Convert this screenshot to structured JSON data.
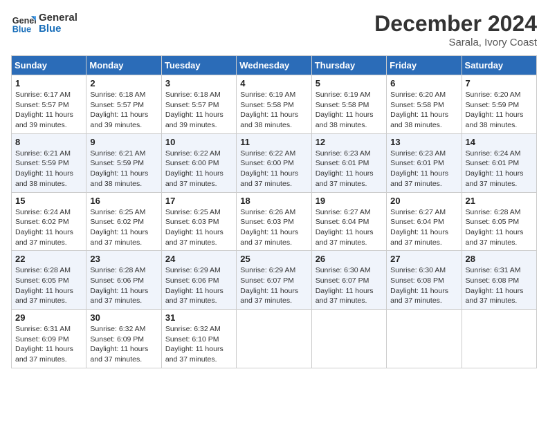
{
  "header": {
    "logo_line1": "General",
    "logo_line2": "Blue",
    "month": "December 2024",
    "location": "Sarala, Ivory Coast"
  },
  "days_of_week": [
    "Sunday",
    "Monday",
    "Tuesday",
    "Wednesday",
    "Thursday",
    "Friday",
    "Saturday"
  ],
  "weeks": [
    [
      {
        "day": "1",
        "info": "Sunrise: 6:17 AM\nSunset: 5:57 PM\nDaylight: 11 hours and 39 minutes."
      },
      {
        "day": "2",
        "info": "Sunrise: 6:18 AM\nSunset: 5:57 PM\nDaylight: 11 hours and 39 minutes."
      },
      {
        "day": "3",
        "info": "Sunrise: 6:18 AM\nSunset: 5:57 PM\nDaylight: 11 hours and 39 minutes."
      },
      {
        "day": "4",
        "info": "Sunrise: 6:19 AM\nSunset: 5:58 PM\nDaylight: 11 hours and 38 minutes."
      },
      {
        "day": "5",
        "info": "Sunrise: 6:19 AM\nSunset: 5:58 PM\nDaylight: 11 hours and 38 minutes."
      },
      {
        "day": "6",
        "info": "Sunrise: 6:20 AM\nSunset: 5:58 PM\nDaylight: 11 hours and 38 minutes."
      },
      {
        "day": "7",
        "info": "Sunrise: 6:20 AM\nSunset: 5:59 PM\nDaylight: 11 hours and 38 minutes."
      }
    ],
    [
      {
        "day": "8",
        "info": "Sunrise: 6:21 AM\nSunset: 5:59 PM\nDaylight: 11 hours and 38 minutes."
      },
      {
        "day": "9",
        "info": "Sunrise: 6:21 AM\nSunset: 5:59 PM\nDaylight: 11 hours and 38 minutes."
      },
      {
        "day": "10",
        "info": "Sunrise: 6:22 AM\nSunset: 6:00 PM\nDaylight: 11 hours and 37 minutes."
      },
      {
        "day": "11",
        "info": "Sunrise: 6:22 AM\nSunset: 6:00 PM\nDaylight: 11 hours and 37 minutes."
      },
      {
        "day": "12",
        "info": "Sunrise: 6:23 AM\nSunset: 6:01 PM\nDaylight: 11 hours and 37 minutes."
      },
      {
        "day": "13",
        "info": "Sunrise: 6:23 AM\nSunset: 6:01 PM\nDaylight: 11 hours and 37 minutes."
      },
      {
        "day": "14",
        "info": "Sunrise: 6:24 AM\nSunset: 6:01 PM\nDaylight: 11 hours and 37 minutes."
      }
    ],
    [
      {
        "day": "15",
        "info": "Sunrise: 6:24 AM\nSunset: 6:02 PM\nDaylight: 11 hours and 37 minutes."
      },
      {
        "day": "16",
        "info": "Sunrise: 6:25 AM\nSunset: 6:02 PM\nDaylight: 11 hours and 37 minutes."
      },
      {
        "day": "17",
        "info": "Sunrise: 6:25 AM\nSunset: 6:03 PM\nDaylight: 11 hours and 37 minutes."
      },
      {
        "day": "18",
        "info": "Sunrise: 6:26 AM\nSunset: 6:03 PM\nDaylight: 11 hours and 37 minutes."
      },
      {
        "day": "19",
        "info": "Sunrise: 6:27 AM\nSunset: 6:04 PM\nDaylight: 11 hours and 37 minutes."
      },
      {
        "day": "20",
        "info": "Sunrise: 6:27 AM\nSunset: 6:04 PM\nDaylight: 11 hours and 37 minutes."
      },
      {
        "day": "21",
        "info": "Sunrise: 6:28 AM\nSunset: 6:05 PM\nDaylight: 11 hours and 37 minutes."
      }
    ],
    [
      {
        "day": "22",
        "info": "Sunrise: 6:28 AM\nSunset: 6:05 PM\nDaylight: 11 hours and 37 minutes."
      },
      {
        "day": "23",
        "info": "Sunrise: 6:28 AM\nSunset: 6:06 PM\nDaylight: 11 hours and 37 minutes."
      },
      {
        "day": "24",
        "info": "Sunrise: 6:29 AM\nSunset: 6:06 PM\nDaylight: 11 hours and 37 minutes."
      },
      {
        "day": "25",
        "info": "Sunrise: 6:29 AM\nSunset: 6:07 PM\nDaylight: 11 hours and 37 minutes."
      },
      {
        "day": "26",
        "info": "Sunrise: 6:30 AM\nSunset: 6:07 PM\nDaylight: 11 hours and 37 minutes."
      },
      {
        "day": "27",
        "info": "Sunrise: 6:30 AM\nSunset: 6:08 PM\nDaylight: 11 hours and 37 minutes."
      },
      {
        "day": "28",
        "info": "Sunrise: 6:31 AM\nSunset: 6:08 PM\nDaylight: 11 hours and 37 minutes."
      }
    ],
    [
      {
        "day": "29",
        "info": "Sunrise: 6:31 AM\nSunset: 6:09 PM\nDaylight: 11 hours and 37 minutes."
      },
      {
        "day": "30",
        "info": "Sunrise: 6:32 AM\nSunset: 6:09 PM\nDaylight: 11 hours and 37 minutes."
      },
      {
        "day": "31",
        "info": "Sunrise: 6:32 AM\nSunset: 6:10 PM\nDaylight: 11 hours and 37 minutes."
      },
      null,
      null,
      null,
      null
    ]
  ]
}
